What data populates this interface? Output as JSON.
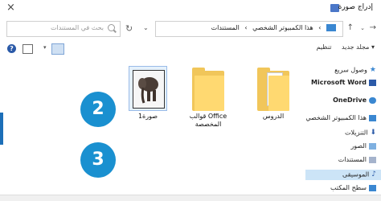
{
  "titlebar": {
    "title": "إدراج صورة",
    "close_glyph": "×"
  },
  "address": {
    "breadcrumb": [
      "هذا الكمبيوتر الشخصي",
      "المستندات"
    ],
    "separator": "›",
    "search_placeholder": "بحث في المستندات"
  },
  "toolbar": {
    "organize": "تنظيم ▾",
    "new_folder": "مجلد جديد",
    "help": "?"
  },
  "sidebar": {
    "items": [
      {
        "label": "وصول سريع",
        "icon": "star-icon",
        "color": "#3a87d1"
      },
      {
        "label": "Microsoft Word",
        "icon": "word-icon",
        "color": "#2b5aa8"
      },
      {
        "label": "OneDrive",
        "icon": "cloud-icon",
        "color": "#3a87d1"
      },
      {
        "label": "هذا الكمبيوتر الشخصي",
        "icon": "pc-icon",
        "color": "#3a87d1"
      },
      {
        "label": "التنزيلات",
        "icon": "download-icon",
        "color": "#2b5aa8"
      },
      {
        "label": "الصور",
        "icon": "pictures-icon",
        "color": "#3a87d1"
      },
      {
        "label": "المستندات",
        "icon": "documents-icon",
        "color": "#6a7fa8",
        "selected": true
      },
      {
        "label": "الموسيقى",
        "icon": "music-icon",
        "color": "#2b5aa8"
      },
      {
        "label": "سطح المكتب",
        "icon": "desktop-icon",
        "color": "#3a87d1"
      }
    ]
  },
  "files": [
    {
      "label": "الدروس",
      "type": "folder-with-document"
    },
    {
      "label": "قوالب Office المخصصة",
      "type": "folder"
    },
    {
      "label": "صورة1",
      "type": "image",
      "selected": true
    }
  ],
  "callouts": {
    "one": "2",
    "two": "3"
  }
}
